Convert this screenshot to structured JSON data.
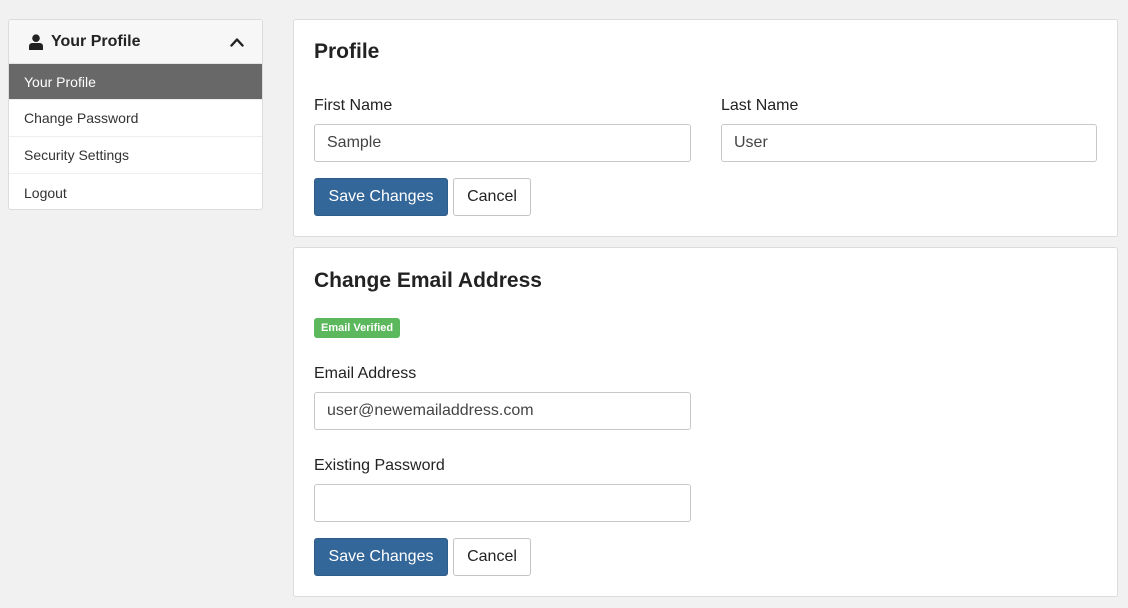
{
  "sidebar": {
    "header_title": "Your Profile",
    "items": [
      {
        "label": "Your Profile",
        "active": true
      },
      {
        "label": "Change Password"
      },
      {
        "label": "Security Settings"
      },
      {
        "label": "Logout"
      }
    ]
  },
  "profile": {
    "title": "Profile",
    "first_name_label": "First Name",
    "first_name_value": "Sample",
    "last_name_label": "Last Name",
    "last_name_value": "User",
    "save_label": "Save Changes",
    "cancel_label": "Cancel"
  },
  "email": {
    "title": "Change Email Address",
    "badge": "Email Verified",
    "email_label": "Email Address",
    "email_value": "user@newemailaddress.com",
    "password_label": "Existing Password",
    "password_value": "",
    "save_label": "Save Changes",
    "cancel_label": "Cancel"
  },
  "colors": {
    "primary": "#336699",
    "active_nav": "#686868",
    "verified": "#5cb85c"
  }
}
